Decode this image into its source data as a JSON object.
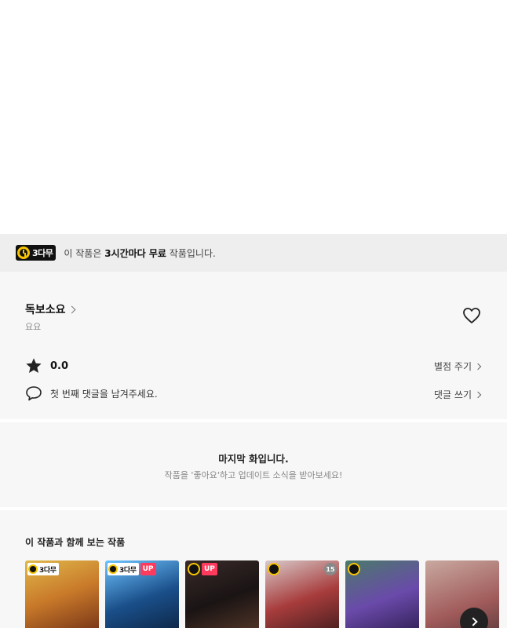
{
  "banner": {
    "badge_label": "3다무",
    "text_prefix": "이 작품은 ",
    "text_bold": "3시간마다 무료",
    "text_suffix": " 작품입니다."
  },
  "work_info": {
    "author": "독보소요",
    "sub_author": "요요",
    "rating": "0.0",
    "rate_label": "별점 주기",
    "comment_prompt": "첫 번째 댓글을 남겨주세요.",
    "comment_label": "댓글 쓰기"
  },
  "last_episode": {
    "title": "마지막 화입니다.",
    "subtitle": "작품을 '좋아요'하고 업데이트 소식을 받아보세요!"
  },
  "recommend": {
    "title": "이 작품과 함께 보는 작품",
    "cards": [
      {
        "badge": "3다무",
        "up": "",
        "age": ""
      },
      {
        "badge": "3다무",
        "up": "UP",
        "age": ""
      },
      {
        "badge": "",
        "up": "UP",
        "age": ""
      },
      {
        "badge": "",
        "up": "",
        "age": "15"
      },
      {
        "badge": "",
        "up": "",
        "age": ""
      },
      {
        "badge": "",
        "up": "",
        "age": ""
      }
    ]
  },
  "colors": {
    "accent_yellow": "#f6c400",
    "up_badge": "#ff3a5c"
  }
}
